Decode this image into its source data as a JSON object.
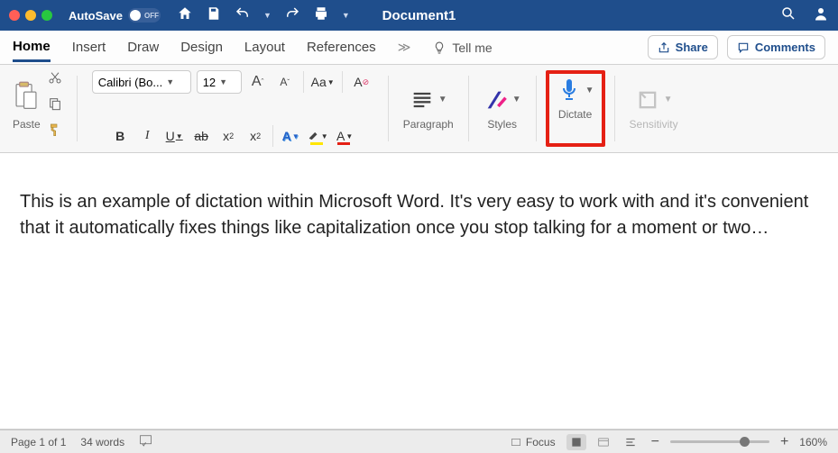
{
  "titlebar": {
    "autosave_label": "AutoSave",
    "autosave_state": "OFF",
    "document_title": "Document1"
  },
  "tabs": {
    "items": [
      "Home",
      "Insert",
      "Draw",
      "Design",
      "Layout",
      "References"
    ],
    "active_index": 0,
    "tell_me": "Tell me",
    "share_label": "Share",
    "comments_label": "Comments"
  },
  "ribbon": {
    "paste_label": "Paste",
    "font_name": "Calibri (Bo...",
    "font_size": "12",
    "paragraph_label": "Paragraph",
    "styles_label": "Styles",
    "dictate_label": "Dictate",
    "sensitivity_label": "Sensitivity",
    "case_btn": "Aa"
  },
  "document_body": "This is an example of dictation within Microsoft Word. It's very easy to work with and it's convenient that it automatically fixes things like capitalization once you stop talking for a moment or two…",
  "statusbar": {
    "page_info": "Page 1 of 1",
    "word_count": "34 words",
    "focus_label": "Focus",
    "zoom_level": "160%"
  }
}
